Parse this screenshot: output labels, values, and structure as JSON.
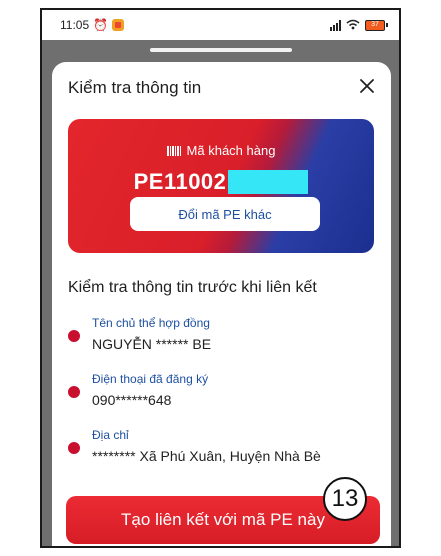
{
  "status_bar": {
    "time": "11:05",
    "battery_level": "37"
  },
  "sheet": {
    "title": "Kiểm tra thông tin"
  },
  "customer_card": {
    "label": "Mã khách hàng",
    "code_visible": "PE11002",
    "change_button": "Đổi mã PE khác",
    "colors": {
      "red": "#e3262b",
      "blue": "#1b2f8f",
      "redact": "#35e6f6"
    }
  },
  "verify": {
    "heading": "Kiểm tra thông tin trước khi liên kết",
    "items": [
      {
        "label": "Tên chủ thể hợp đồng",
        "value": "NGUYỄN ****** BE"
      },
      {
        "label": "Điện thoại đã đăng ký",
        "value": "090******648"
      },
      {
        "label": "Địa chỉ",
        "value": "******** Xã Phú Xuân, Huyện Nhà Bè"
      }
    ]
  },
  "cta": {
    "label": "Tạo liên kết với mã PE này"
  },
  "annotation": {
    "step": "13"
  },
  "icons": {
    "close": "close-icon",
    "barcode": "barcode-icon",
    "signal": "signal-icon",
    "wifi": "wifi-icon",
    "battery": "battery-icon",
    "alarm": "alarm-icon"
  }
}
